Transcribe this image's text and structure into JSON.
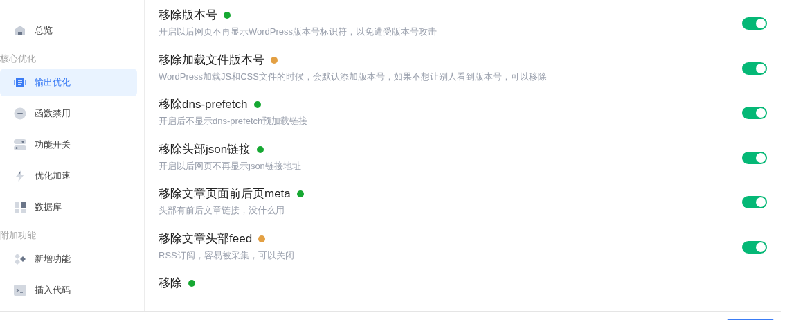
{
  "sidebar": {
    "items": [
      {
        "kind": "item",
        "label": "总览",
        "selected": false
      },
      {
        "kind": "heading",
        "label": "核心优化"
      },
      {
        "kind": "item",
        "label": "输出优化",
        "selected": true
      },
      {
        "kind": "item",
        "label": "函数禁用",
        "selected": false
      },
      {
        "kind": "item",
        "label": "功能开关",
        "selected": false
      },
      {
        "kind": "item",
        "label": "优化加速",
        "selected": false
      },
      {
        "kind": "item",
        "label": "数据库",
        "selected": false
      },
      {
        "kind": "heading",
        "label": "附加功能"
      },
      {
        "kind": "item",
        "label": "新增功能",
        "selected": false
      },
      {
        "kind": "item",
        "label": "插入代码",
        "selected": false
      }
    ]
  },
  "settings": [
    {
      "title": "移除版本号",
      "color": "#16a832",
      "description": "开启以后网页不再显示WordPress版本号标识符，以免遭受版本号攻击",
      "on": true
    },
    {
      "title": "移除加载文件版本号",
      "color": "#e3a043",
      "description": "WordPress加载JS和CSS文件的时候，会默认添加版本号，如果不想让别人看到版本号，可以移除",
      "on": true
    },
    {
      "title": "移除dns-prefetch",
      "color": "#16a832",
      "description": "开启后不显示dns-prefetch预加载链接",
      "on": true
    },
    {
      "title": "移除头部json链接",
      "color": "#16a832",
      "description": "开启以后网页不再显示json链接地址",
      "on": true
    },
    {
      "title": "移除文章页面前后页meta",
      "color": "#16a832",
      "description": "头部有前后文章链接，没什么用",
      "on": true
    },
    {
      "title": "移除文章头部feed",
      "color": "#e3a043",
      "description": "RSS订阅，容易被采集，可以关闭",
      "on": true
    },
    {
      "title": "移除",
      "color": "#16a832"
    }
  ]
}
